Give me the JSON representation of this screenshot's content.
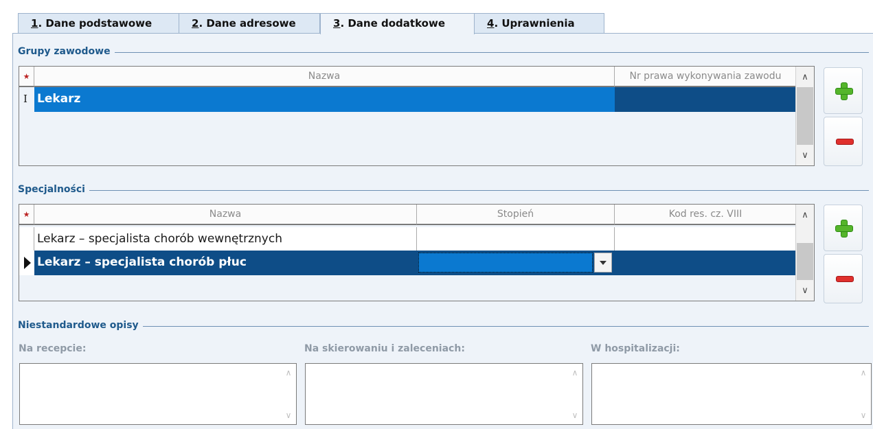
{
  "tabs": [
    {
      "num": "1",
      "text": ". Dane podstawowe"
    },
    {
      "num": "2",
      "text": ". Dane adresowe"
    },
    {
      "num": "3",
      "text": ". Dane dodatkowe"
    },
    {
      "num": "4",
      "text": ". Uprawnienia"
    }
  ],
  "active_tab": 2,
  "grupy": {
    "title": "Grupy zawodowe",
    "columns": [
      "Nazwa",
      "Nr prawa wykonywania zawodu"
    ],
    "rows": [
      {
        "nazwa": "Lekarz",
        "nr": ""
      }
    ],
    "required_marker": "★",
    "row_indicator": "I"
  },
  "specjalnosci": {
    "title": "Specjalności",
    "columns": [
      "Nazwa",
      "Stopień",
      "Kod res. cz. VIII"
    ],
    "rows": [
      {
        "nazwa": "Lekarz – specjalista chorób wewnętrznych",
        "stopien": "",
        "kod": ""
      },
      {
        "nazwa": "Lekarz – specjalista chorób płuc",
        "stopien": "",
        "kod": ""
      }
    ],
    "required_marker": "★"
  },
  "opisy": {
    "title": "Niestandardowe opisy",
    "recepta_label": "Na recepcie:",
    "skierowanie_label": "Na skierowaniu i zaleceniach:",
    "hospitalizacja_label": "W hospitalizacji:",
    "recepta_value": "",
    "skierowanie_value": "",
    "hospitalizacja_value": ""
  },
  "colors": {
    "selection": "#0b79d0",
    "selection_dark": "#0e4d87",
    "group_title": "#1f5a8c"
  }
}
